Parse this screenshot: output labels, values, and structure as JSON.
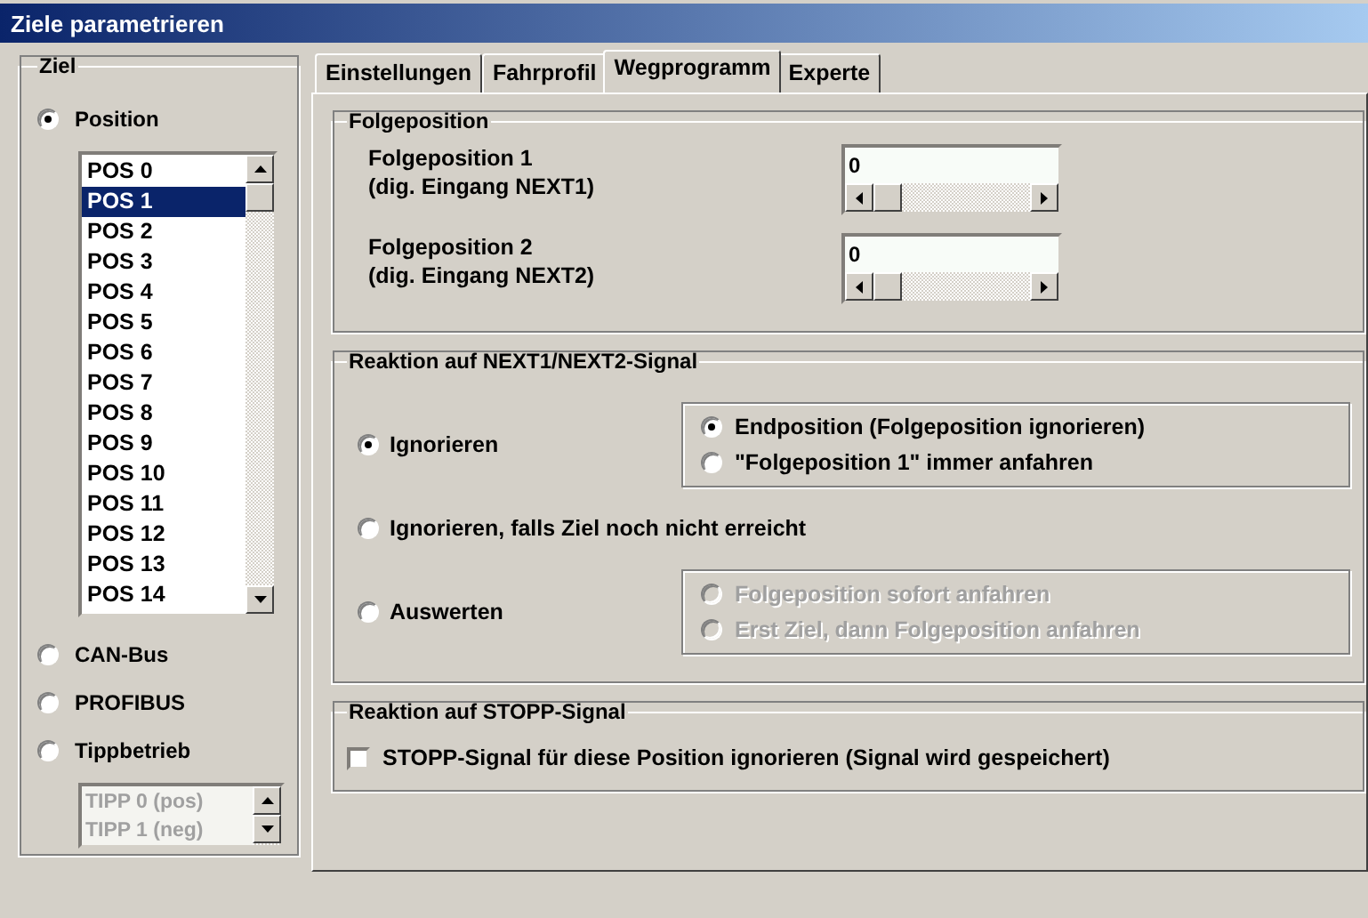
{
  "window": {
    "title": "Ziele parametrieren"
  },
  "ziel": {
    "title": "Ziel",
    "options": [
      {
        "label": "Position",
        "selected": true,
        "list": {
          "disabled": false,
          "items": [
            {
              "label": "POS 0",
              "selected": false
            },
            {
              "label": "POS 1",
              "selected": true
            },
            {
              "label": "POS 2",
              "selected": false
            },
            {
              "label": "POS 3",
              "selected": false
            },
            {
              "label": "POS 4",
              "selected": false
            },
            {
              "label": "POS 5",
              "selected": false
            },
            {
              "label": "POS 6",
              "selected": false
            },
            {
              "label": "POS 7",
              "selected": false
            },
            {
              "label": "POS 8",
              "selected": false
            },
            {
              "label": "POS 9",
              "selected": false
            },
            {
              "label": "POS 10",
              "selected": false
            },
            {
              "label": "POS 11",
              "selected": false
            },
            {
              "label": "POS 12",
              "selected": false
            },
            {
              "label": "POS 13",
              "selected": false
            },
            {
              "label": "POS 14",
              "selected": false
            }
          ]
        }
      },
      {
        "label": "CAN-Bus",
        "selected": false
      },
      {
        "label": "PROFIBUS",
        "selected": false
      },
      {
        "label": "Tippbetrieb",
        "selected": false,
        "list": {
          "disabled": true,
          "items": [
            {
              "label": "TIPP 0 (pos)",
              "selected": false
            },
            {
              "label": "TIPP 1 (neg)",
              "selected": false
            }
          ]
        }
      }
    ]
  },
  "tabs": [
    {
      "label": "Einstellungen",
      "selected": false
    },
    {
      "label": "Fahrprofil",
      "selected": false
    },
    {
      "label": "Wegprogramm",
      "selected": true
    },
    {
      "label": "Experte",
      "selected": false
    }
  ],
  "folgeposition": {
    "title": "Folgeposition",
    "fields": [
      {
        "label": "Folgeposition 1",
        "sublabel": "(dig. Eingang NEXT1)",
        "value": "0"
      },
      {
        "label": "Folgeposition 2",
        "sublabel": "(dig. Eingang NEXT2)",
        "value": "0"
      }
    ]
  },
  "reaktion_next": {
    "title": "Reaktion auf NEXT1/NEXT2-Signal",
    "options": [
      {
        "label": "Ignorieren",
        "selected": true,
        "suboptions": {
          "disabled": false,
          "options": [
            {
              "label": "Endposition (Folgeposition ignorieren)",
              "selected": true
            },
            {
              "label": "\"Folgeposition 1\" immer anfahren",
              "selected": false
            }
          ]
        }
      },
      {
        "label": "Ignorieren, falls Ziel noch nicht erreicht",
        "selected": false
      },
      {
        "label": "Auswerten",
        "selected": false,
        "suboptions": {
          "disabled": true,
          "options": [
            {
              "label": "Folgeposition sofort anfahren",
              "selected": false
            },
            {
              "label": "Erst Ziel, dann Folgeposition anfahren",
              "selected": false
            }
          ]
        }
      }
    ]
  },
  "reaktion_stopp": {
    "title": "Reaktion auf STOPP-Signal",
    "checkbox": {
      "label": "STOPP-Signal für diese Position ignorieren (Signal wird gespeichert)",
      "checked": false
    }
  }
}
